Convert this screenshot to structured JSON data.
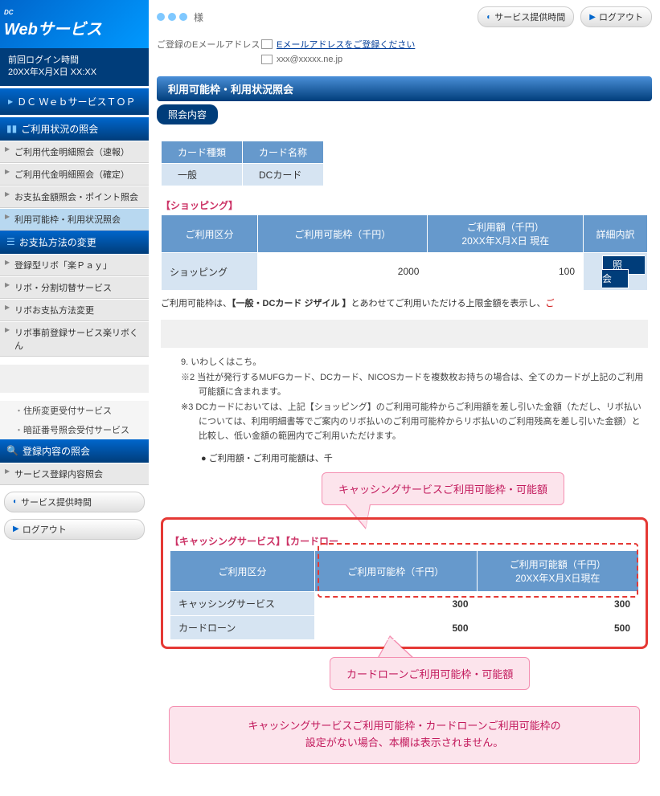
{
  "logo": {
    "dc": "DC",
    "main": "Webサービス"
  },
  "loginTime": {
    "line1": "前回ログイン時間",
    "line2": "20XX年X月X日 XX:XX"
  },
  "topButton": "ＤＣ ＷｅｂサービスＴＯＰ",
  "sections": {
    "s1": {
      "title": "ご利用状況の照会",
      "items": [
        "ご利用代金明細照会（速報）",
        "ご利用代金明細照会（確定）",
        "お支払金額照会・ポイント照会",
        "利用可能枠・利用状況照会"
      ]
    },
    "s2": {
      "title": "お支払方法の変更",
      "items": [
        "登録型リボ「楽Ｐａｙ」",
        "リボ・分割切替サービス",
        "リボお支払方法変更",
        "リボ事前登録サービス楽リボくん"
      ]
    },
    "s3": {
      "items": [
        "住所変更受付サービス",
        "暗証番号照会受付サービス"
      ]
    },
    "s4": {
      "title": "登録内容の照会",
      "items": [
        "サービス登録内容照会"
      ]
    }
  },
  "serviceButtons": {
    "b1": "サービス提供時間",
    "b2": "ログアウト"
  },
  "userSuffix": "様",
  "topBarButtons": {
    "b1": "サービス提供時間",
    "b2": "ログアウト"
  },
  "email": {
    "label": "ご登録のEメールアドレス",
    "registerLink": "Eメールアドレスをご登録ください",
    "address": "xxx@xxxxx.ne.jp"
  },
  "pageTitle": "利用可能枠・利用状況照会",
  "subTitle": "照会内容",
  "cardTable": {
    "h1": "カード種類",
    "h2": "カード名称",
    "v1": "一般",
    "v2": "DCカード"
  },
  "shopping": {
    "label": "【ショッピング】",
    "h1": "ご利用区分",
    "h2": "ご利用可能枠（千円）",
    "h3": "ご利用額（千円）\n20XX年X月X日 現在",
    "h4": "詳細内訳",
    "row1": {
      "label": "ショッピング",
      "limit": "2000",
      "used": "100",
      "btn": "照　会"
    }
  },
  "descText": {
    "pre": "ご利用可能枠は、",
    "bold": "【一般・DCカード ジザイル 】",
    "post": "とあわせてご利用いただける上限金額を表示し、",
    "red": "ご"
  },
  "clippedNote": "9. いわしくは",
  "linkText": "こち",
  "notes": {
    "n2": "※2 当社が発行するMUFGカード、DCカード、NICOSカードを複数枚お持ちの場合は、全てのカードが上記のご利用可能額に含まれます。",
    "n3": "※3 DCカードにおいては、上記【ショッピング】のご利用可能枠からご利用額を差し引いた金額（ただし、リボ払いについては、利用明細書等でご案内のリボ払いのご利用可能枠からリボ払いのご利用残高を差し引いた金額）と比較し、低い金額の範囲内でご利用いただけます。"
  },
  "bulletNote": "● ご利用額・ご利用可能額は、千",
  "callout1": "キャッシングサービスご利用可能枠・可能額",
  "cashSection": {
    "label": "【キャッシングサービス】【カードロー",
    "h1": "ご利用区分",
    "h2": "ご利用可能枠（千円）",
    "h3": "ご利用可能額（千円）\n20XX年X月X日現在",
    "row1": {
      "label": "キャッシングサービス",
      "limit": "300",
      "avail": "300"
    },
    "row2": {
      "label": "カードローン",
      "limit": "500",
      "avail": "500"
    }
  },
  "callout2": "カードローンご利用可能枠・可能額",
  "infoBox": "キャッシングサービスご利用可能枠・カードローンご利用可能枠の\n設定がない場合、本欄は表示されません。"
}
